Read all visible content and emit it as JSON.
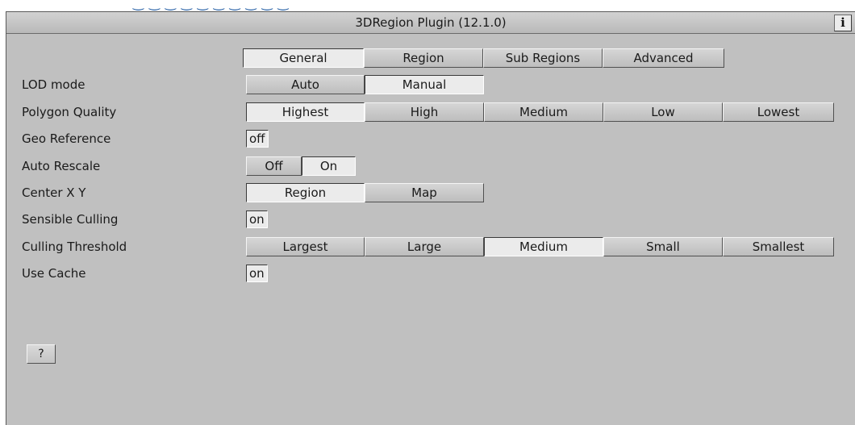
{
  "panel": {
    "title": "3DRegion Plugin (12.1.0)",
    "info_label": "i"
  },
  "tabs": [
    {
      "label": "General",
      "selected": true
    },
    {
      "label": "Region",
      "selected": false
    },
    {
      "label": "Sub Regions",
      "selected": false
    },
    {
      "label": "Advanced",
      "selected": false
    }
  ],
  "rows": {
    "lod_mode": {
      "label": "LOD mode",
      "options": [
        {
          "label": "Auto",
          "selected": false
        },
        {
          "label": "Manual",
          "selected": true
        }
      ]
    },
    "polygon_quality": {
      "label": "Polygon Quality",
      "options": [
        {
          "label": "Highest",
          "selected": true
        },
        {
          "label": "High",
          "selected": false
        },
        {
          "label": "Medium",
          "selected": false
        },
        {
          "label": "Low",
          "selected": false
        },
        {
          "label": "Lowest",
          "selected": false
        }
      ]
    },
    "geo_reference": {
      "label": "Geo Reference",
      "value": "off"
    },
    "auto_rescale": {
      "label": "Auto Rescale",
      "options": [
        {
          "label": "Off",
          "selected": false
        },
        {
          "label": "On",
          "selected": true
        }
      ]
    },
    "center_xy": {
      "label": "Center X Y",
      "options": [
        {
          "label": "Region",
          "selected": true
        },
        {
          "label": "Map",
          "selected": false
        }
      ]
    },
    "sensible_culling": {
      "label": "Sensible Culling",
      "value": "on"
    },
    "culling_threshold": {
      "label": "Culling Threshold",
      "options": [
        {
          "label": "Largest",
          "selected": false
        },
        {
          "label": "Large",
          "selected": false
        },
        {
          "label": "Medium",
          "selected": true
        },
        {
          "label": "Small",
          "selected": false
        },
        {
          "label": "Smallest",
          "selected": false
        }
      ]
    },
    "use_cache": {
      "label": "Use Cache",
      "value": "on"
    }
  },
  "help": {
    "label": "?"
  }
}
